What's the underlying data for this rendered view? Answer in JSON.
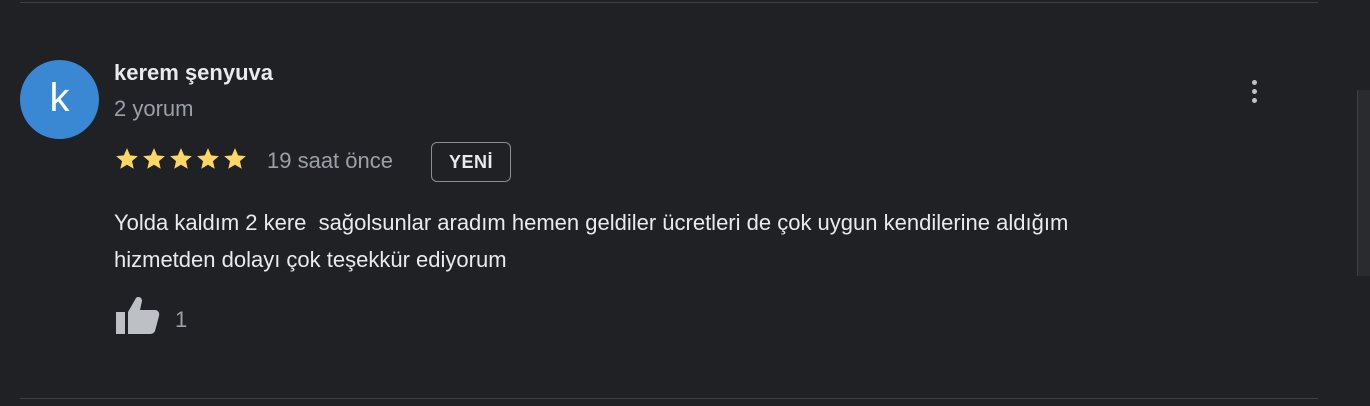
{
  "review": {
    "author": {
      "initial": "k",
      "name": "kerem şenyuva",
      "review_count": "2 yorum",
      "avatar_color": "#3a88d4"
    },
    "rating": 5,
    "rating_max": 5,
    "star_color": "#fdd663",
    "time": "19 saat önce",
    "badge": "YENİ",
    "text": "Yolda kaldım 2 kere  sağolsunlar aradım hemen geldiler ücretleri de çok uygun kendilerine aldığım\nhizmetden dolayı çok teşekkür ediyorum",
    "likes": "1",
    "icons": {
      "more": "more-vert-icon",
      "like": "thumbs-up-icon",
      "star": "star-icon"
    }
  }
}
